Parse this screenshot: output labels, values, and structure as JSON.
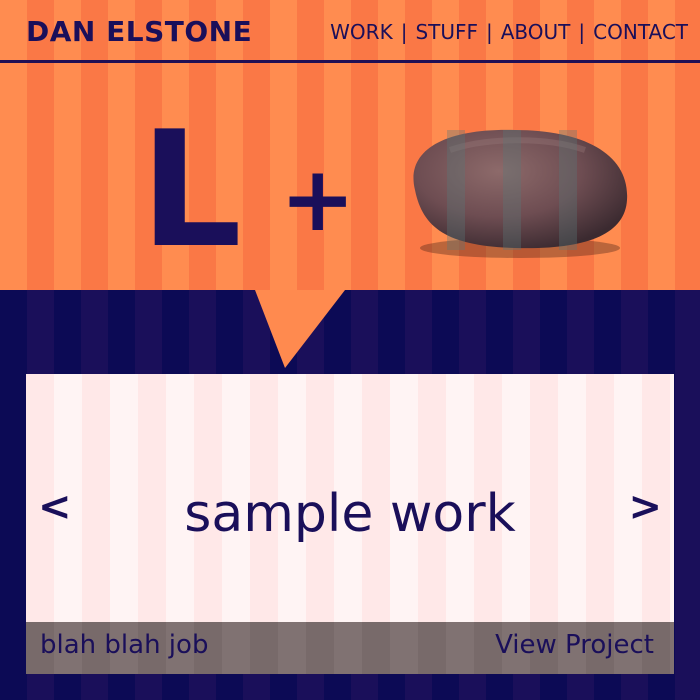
{
  "brand": "DAN ELSTONE",
  "nav": {
    "items": [
      "WORK",
      "STUFF",
      "ABOUT",
      "CONTACT"
    ],
    "separator": "|"
  },
  "hero": {
    "letter": "L",
    "plus": "+",
    "rock_icon": "rock-image"
  },
  "panel": {
    "title": "sample work",
    "prev": "<",
    "next": ">",
    "footer_left": "blah blah job",
    "footer_right": "View Project"
  },
  "colors": {
    "orange": "#ff8a4f",
    "navy": "#0c0a55",
    "panel": "#ffe2e2",
    "text": "#1a0f5a"
  }
}
